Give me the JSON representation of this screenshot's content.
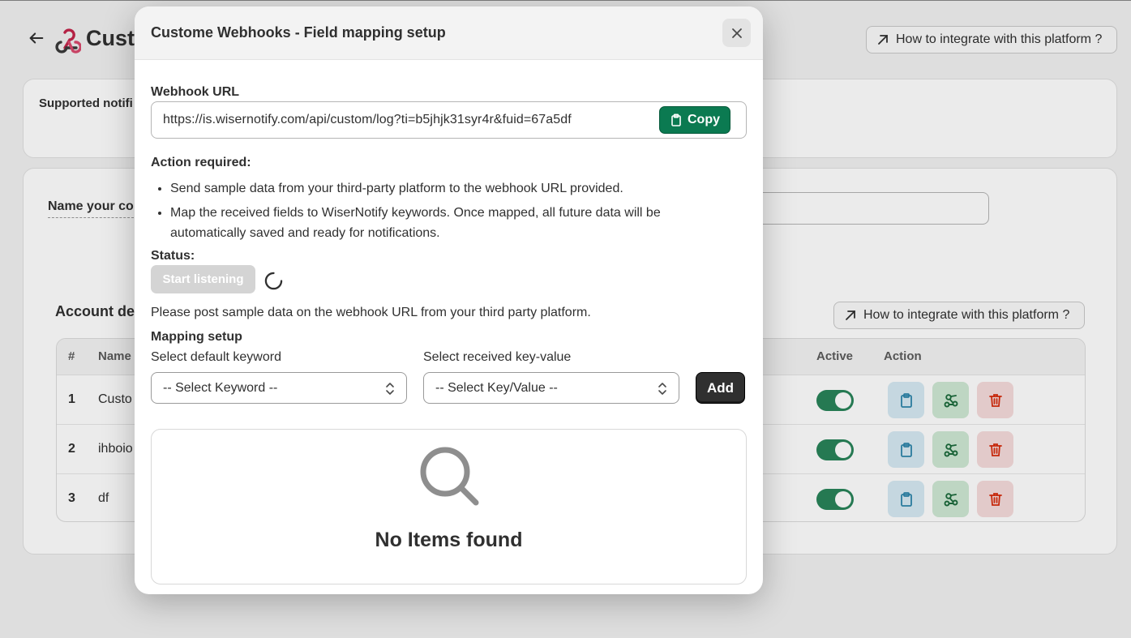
{
  "background": {
    "page_title": "Custo",
    "howto_label": "How to integrate with this platform ?",
    "supported_label": "Supported notifi",
    "name_label": "Name your co",
    "account_title": "Account de",
    "table": {
      "headers": {
        "num": "#",
        "name": "Name",
        "active": "Active",
        "action": "Action"
      },
      "rows": [
        {
          "num": "1",
          "name": "Custo",
          "active": true
        },
        {
          "num": "2",
          "name": "ihboio",
          "active": true
        },
        {
          "num": "3",
          "name": "df",
          "active": true
        }
      ]
    }
  },
  "modal": {
    "title": "Custome Webhooks - Field mapping setup",
    "webhook_label": "Webhook URL",
    "webhook_url": "https://is.wisernotify.com/api/custom/log?ti=b5jhjk31syr4r&fuid=67a5df",
    "copy_label": "Copy",
    "action_required_label": "Action required:",
    "action_items": [
      "Send sample data from your third-party platform to the webhook URL provided.",
      "Map the received fields to WiserNotify keywords. Once mapped, all future data will be automatically saved and ready for notifications."
    ],
    "status_label": "Status:",
    "start_listening_label": "Start listening",
    "status_message": "Please post sample data on the webhook URL from your third party platform.",
    "mapping_label": "Mapping setup",
    "keyword_label": "Select default keyword",
    "keyword_value": "-- Select Keyword --",
    "keyvalue_label": "Select received key-value",
    "keyvalue_value": "-- Select Key/Value --",
    "add_label": "Add",
    "empty_message": "No Items found"
  },
  "colors": {
    "accent_green": "#0b7a51",
    "toggle_green": "#29845a",
    "dark_button": "#303030",
    "disabled_button": "#d4d4d4",
    "delete_red": "#d72c0d",
    "copy_blue": "#2e86ab"
  },
  "icons": [
    "back-arrow-icon",
    "webhook-logo-icon",
    "external-arrow-icon",
    "close-icon",
    "clipboard-icon",
    "spinner-icon",
    "chevron-updown-icon",
    "search-icon",
    "mapping-icon",
    "trash-icon"
  ]
}
